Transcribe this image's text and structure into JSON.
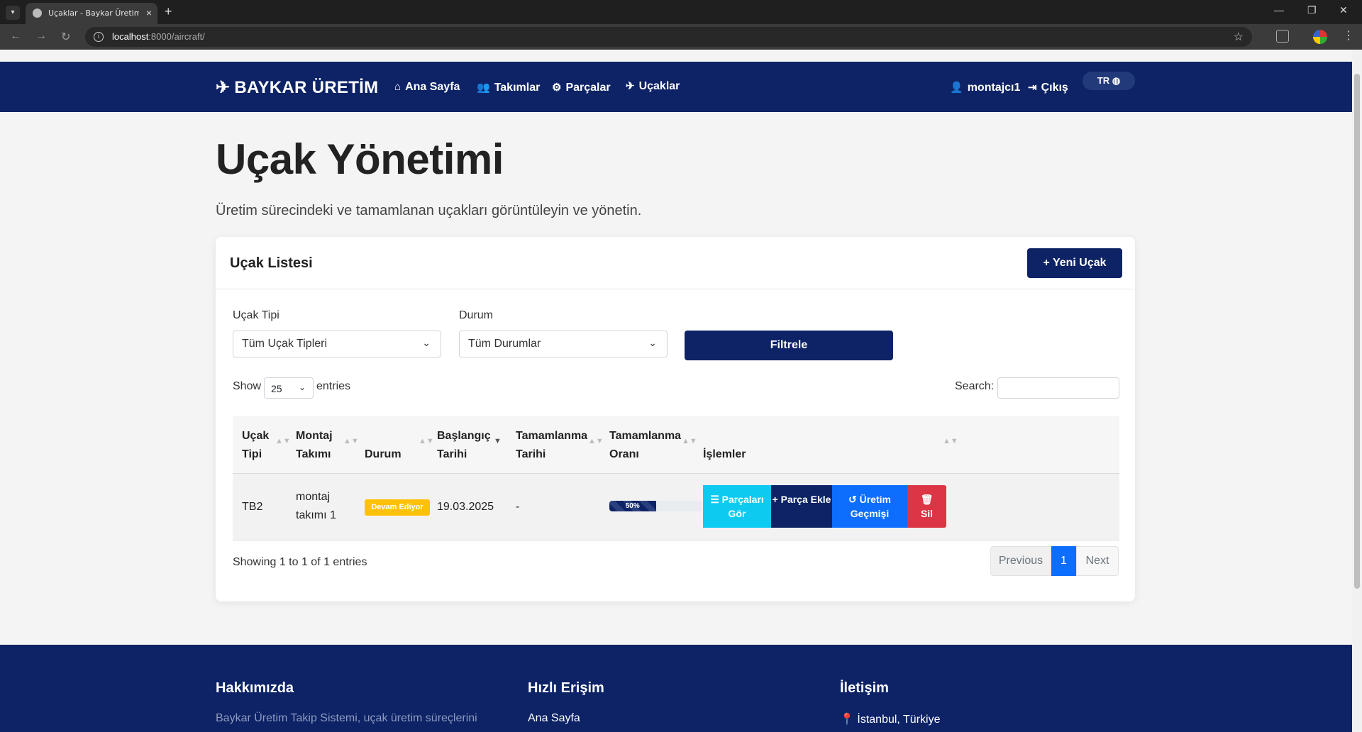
{
  "browser": {
    "tab_title": "Uçaklar - Baykar Üretim Takip Sistemi",
    "tab_close": "×",
    "new_tab": "+",
    "url_host": "localhost",
    "url_path": ":8000/aircraft/"
  },
  "nav": {
    "brand": "BAYKAR ÜRETİM",
    "links": [
      {
        "label": "Ana Sayfa",
        "icon": "home-icon"
      },
      {
        "label": "Takımlar",
        "icon": "users-icon"
      },
      {
        "label": "Parçalar",
        "icon": "cogs-icon"
      },
      {
        "label": "Uçaklar",
        "icon": "plane-icon"
      }
    ],
    "user": "montajcı1",
    "logout": "Çıkış",
    "lang": "TR"
  },
  "page": {
    "title": "Uçak Yönetimi",
    "subtitle": "Üretim sürecindeki ve tamamlanan uçakları görüntüleyin ve yönetin."
  },
  "card": {
    "title": "Uçak Listesi",
    "new_button": "Yeni Uçak",
    "filters": {
      "type_label": "Uçak Tipi",
      "type_value": "Tüm Uçak Tipleri",
      "status_label": "Durum",
      "status_value": "Tüm Durumlar",
      "filter_button": "Filtrele"
    },
    "table_controls": {
      "show": "Show",
      "length": "25",
      "entries": "entries",
      "search": "Search:"
    },
    "columns": [
      "Uçak Tipi",
      "Montaj Takımı",
      "Durum",
      "Başlangıç Tarihi",
      "Tamamlanma Tarihi",
      "Tamamlanma Oranı",
      "İşlemler"
    ],
    "rows": [
      {
        "type": "TB2",
        "team": "montaj takımı 1",
        "status": "Devam Ediyor",
        "start": "19.03.2025",
        "end": "-",
        "progress_label": "50%",
        "progress": 50,
        "actions": [
          "Parçaları Gör",
          "Parça Ekle",
          "Üretim Geçmişi",
          "Sil"
        ]
      }
    ],
    "info": "Showing 1 to 1 of 1 entries",
    "pagination": {
      "previous": "Previous",
      "page": "1",
      "next": "Next"
    }
  },
  "footer": {
    "about_title": "Hakkımızda",
    "about_text": "Baykar Üretim Takip Sistemi, uçak üretim süreçlerini",
    "quick_title": "Hızlı Erişim",
    "quick_link": "Ana Sayfa",
    "contact_title": "İletişim",
    "contact_location": "İstanbul, Türkiye"
  },
  "colors": {
    "primary": "#0d2366",
    "warning": "#ffc107",
    "info": "#0dcaf0",
    "blue": "#0d6efd",
    "danger": "#dc3545"
  }
}
